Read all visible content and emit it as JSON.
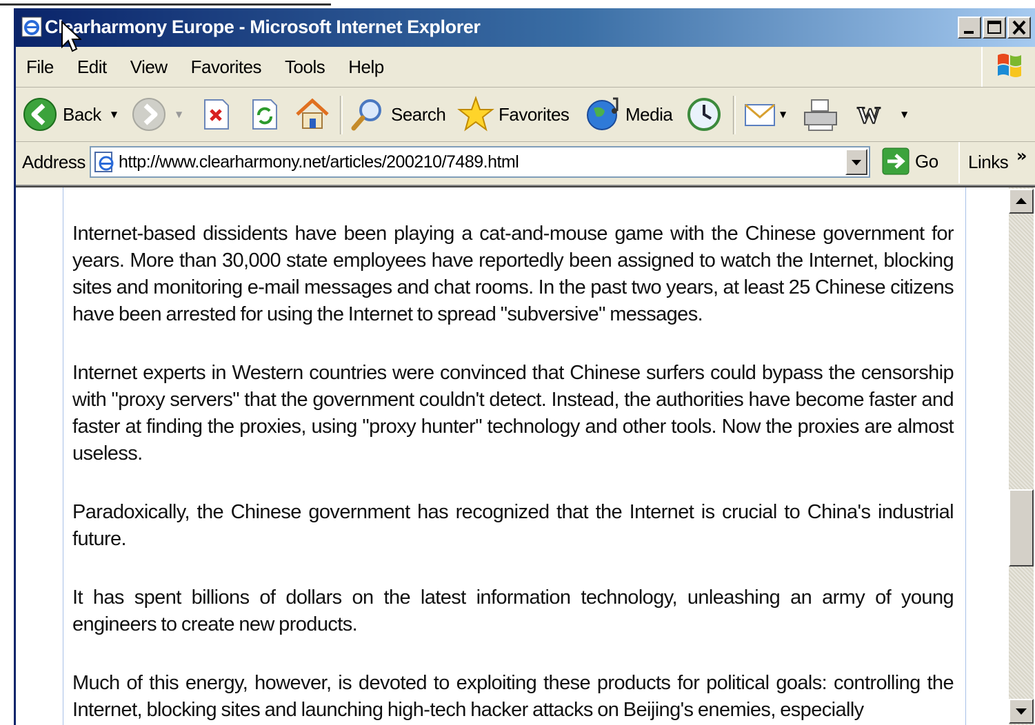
{
  "window": {
    "title": "Clearharmony Europe - Microsoft Internet Explorer",
    "caption_buttons": [
      "minimize",
      "maximize",
      "close"
    ]
  },
  "menubar": {
    "items": [
      "File",
      "Edit",
      "View",
      "Favorites",
      "Tools",
      "Help"
    ]
  },
  "toolbar": {
    "back_label": "Back",
    "search_label": "Search",
    "favorites_label": "Favorites",
    "media_label": "Media"
  },
  "address": {
    "label": "Address",
    "url": "http://www.clearharmony.net/articles/200210/7489.html",
    "go_label": "Go",
    "links_label": "Links"
  },
  "article": {
    "paragraphs": [
      "Internet-based dissidents have been playing a cat-and-mouse game with the Chinese government for years. More than 30,000 state employees have reportedly been assigned to watch the Internet, blocking sites and monitoring e-mail messages and chat rooms. In the past two years, at least 25 Chinese citizens have been arrested for using the Internet to spread \"subversive\" messages.",
      "Internet experts in Western countries were convinced that Chinese surfers could bypass the censorship with \"proxy servers\" that the government couldn't detect. Instead, the authorities have become faster and faster at finding the proxies, using \"proxy hunter\" technology and other tools. Now the proxies are almost useless.",
      "Paradoxically, the Chinese government has recognized that the Internet is crucial to China's industrial future.",
      "It has spent billions of dollars on the latest information technology, unleashing an army of young engineers to create new products.",
      "Much of this energy, however, is devoted to exploiting these products for political goals: controlling the Internet, blocking sites and launching high-tech hacker attacks on Beijing's enemies, especially"
    ]
  },
  "scrollbar": {
    "position_fraction": 0.56
  },
  "colors": {
    "titlebar_start": "#0a246a",
    "titlebar_end": "#a6caf0",
    "chrome": "#ece9d8"
  }
}
